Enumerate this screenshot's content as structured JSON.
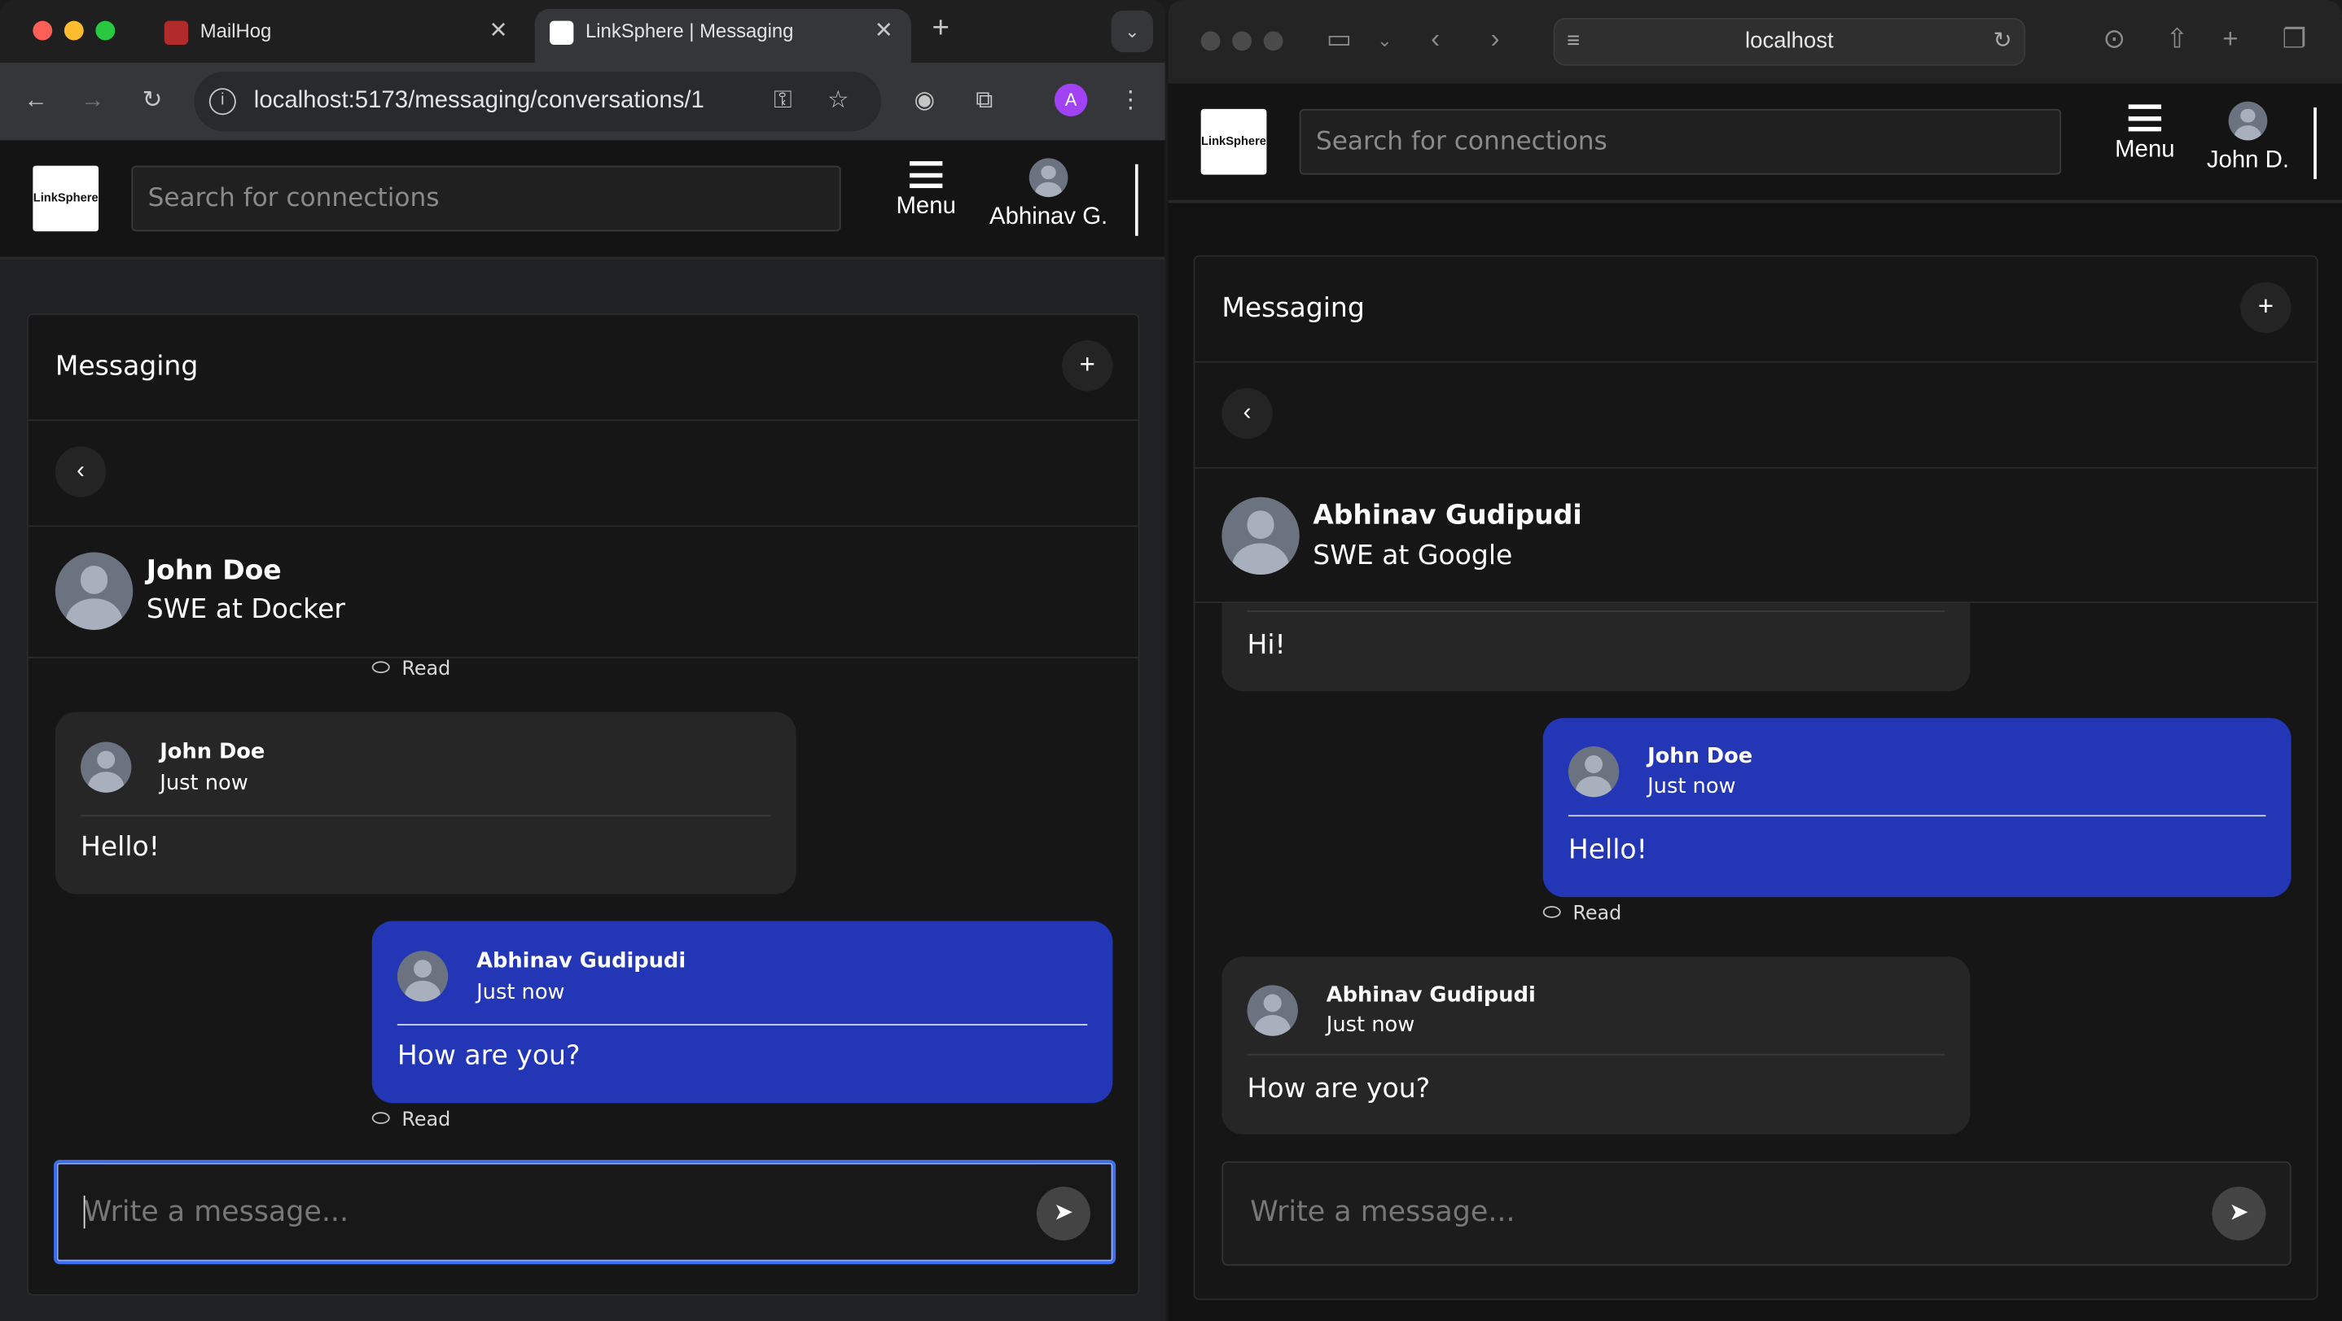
{
  "chrome": {
    "tabs": [
      {
        "label": "MailHog"
      },
      {
        "label": "LinkSphere | Messaging"
      }
    ],
    "url": "localhost:5173/messaging/conversations/1",
    "profile_initial": "A"
  },
  "safari": {
    "url": "localhost"
  },
  "app": {
    "logo_text": "LinkSphere",
    "search_placeholder": "Search for connections",
    "menu_label": "Menu",
    "messaging_title": "Messaging",
    "add_label": "+",
    "back_label": "‹",
    "composer_placeholder": "Write a message..."
  },
  "left": {
    "me_short": "Abhinav G.",
    "peer": {
      "name": "John Doe",
      "title": "SWE at Docker"
    },
    "read_top": "Read",
    "messages": [
      {
        "author": "John Doe",
        "time": "Just now",
        "text": "Hello!",
        "own": false
      },
      {
        "author": "Abhinav Gudipudi",
        "time": "Just now",
        "text": "How are you?",
        "own": true
      }
    ],
    "read_bottom": "Read"
  },
  "right": {
    "me_short": "John D.",
    "peer": {
      "name": "Abhinav Gudipudi",
      "title": "SWE at Google"
    },
    "partial_text": "Hi!",
    "messages": [
      {
        "author": "John Doe",
        "time": "Just now",
        "text": "Hello!",
        "own": true
      },
      {
        "author": "Abhinav Gudipudi",
        "time": "Just now",
        "text": "How are you?",
        "own": false
      }
    ],
    "read_mid": "Read"
  }
}
